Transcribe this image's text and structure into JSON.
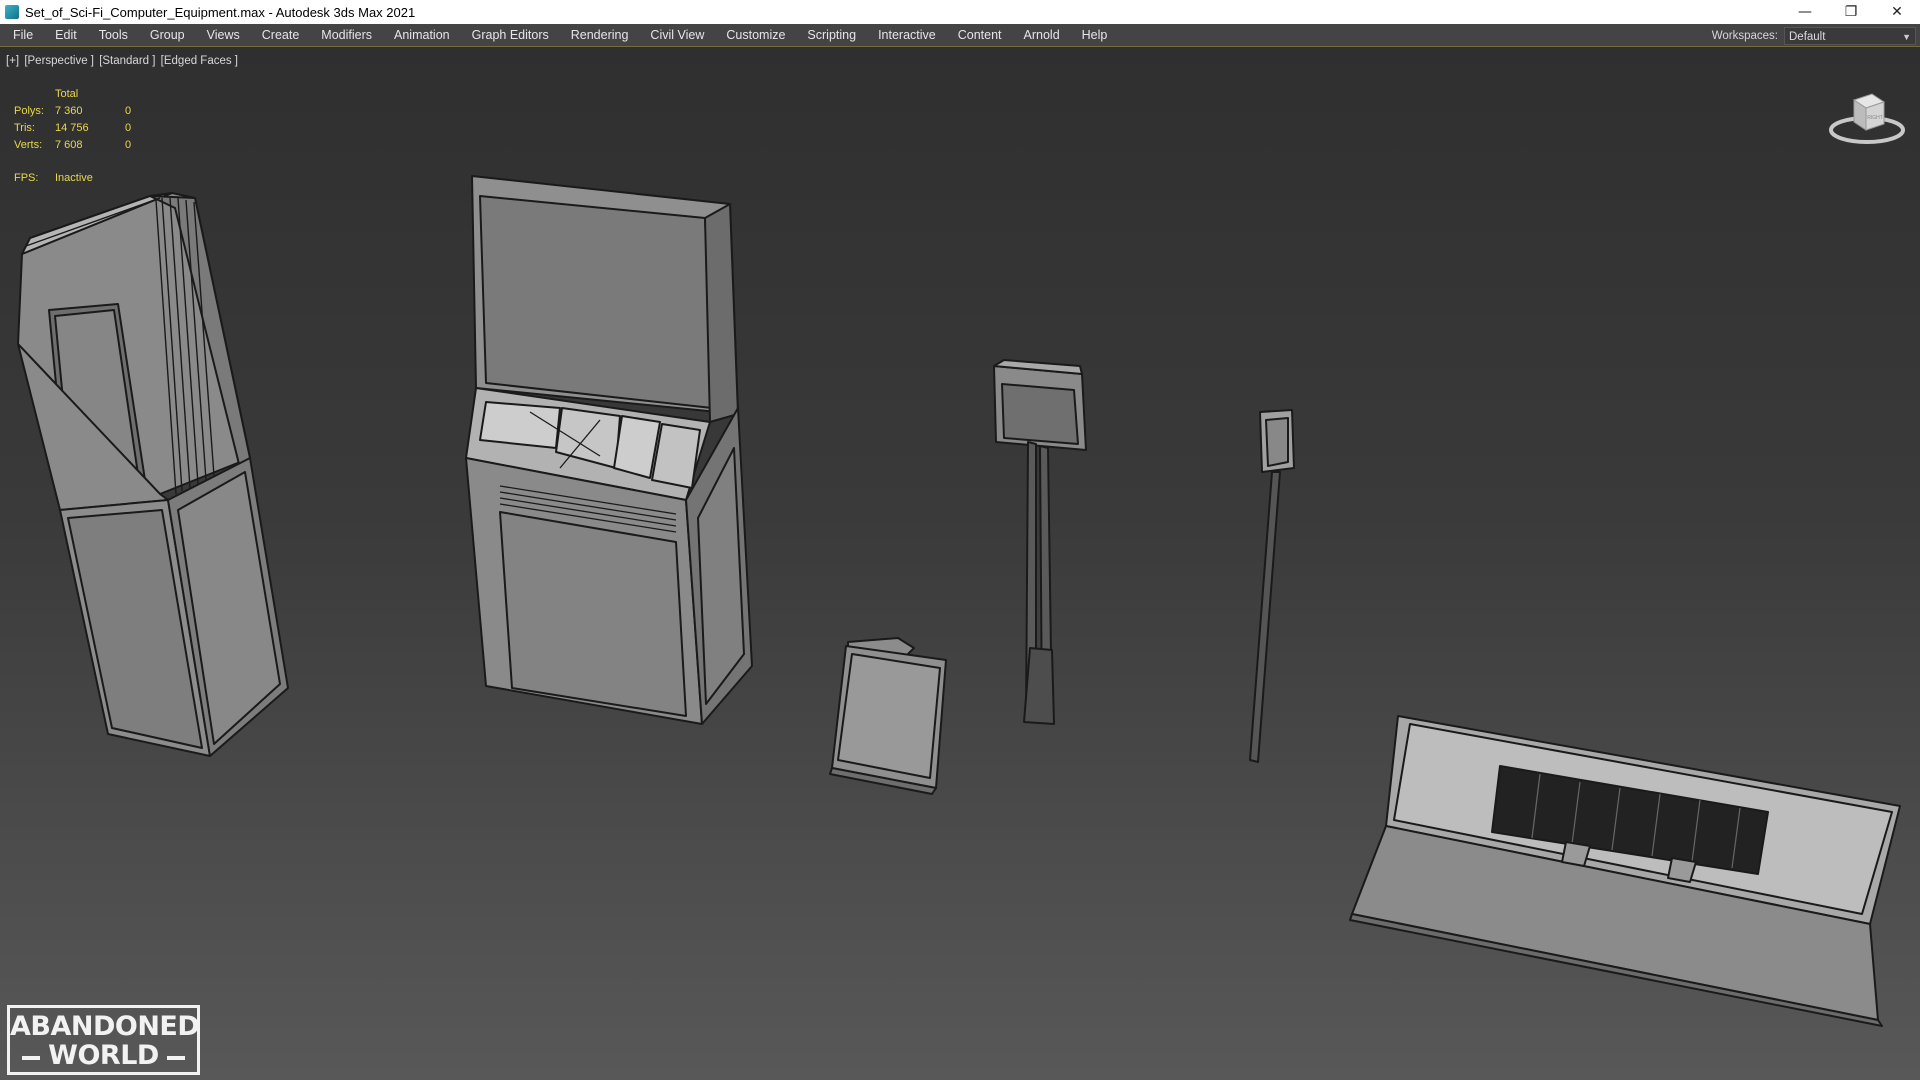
{
  "window": {
    "title": "Set_of_Sci-Fi_Computer_Equipment.max - Autodesk 3ds Max 2021",
    "minimize_glyph": "—",
    "restore_glyph": "❐",
    "close_glyph": "✕"
  },
  "menu": {
    "items": [
      "File",
      "Edit",
      "Tools",
      "Group",
      "Views",
      "Create",
      "Modifiers",
      "Animation",
      "Graph Editors",
      "Rendering",
      "Civil View",
      "Customize",
      "Scripting",
      "Interactive",
      "Content",
      "Arnold",
      "Help"
    ],
    "workspaces_label": "Workspaces:",
    "workspaces_value": "Default"
  },
  "viewport": {
    "labels": [
      "[+]",
      "[Perspective ]",
      "[Standard ]",
      "[Edged Faces ]"
    ],
    "stats": {
      "header": "Total",
      "polys_label": "Polys:",
      "polys_total": "7 360",
      "polys_sel": "0",
      "tris_label": "Tris:",
      "tris_total": "14 756",
      "tris_sel": "0",
      "verts_label": "Verts:",
      "verts_total": "7 608",
      "verts_sel": "0",
      "fps_label": "FPS:",
      "fps_value": "Inactive"
    },
    "viewcube_face": "RIGHT"
  },
  "watermark": {
    "line1": "ABANDONED",
    "line2": "WORLD"
  },
  "colors": {
    "stats_text": "#e8d848",
    "menu_bg": "#444444",
    "mesh_face": "#8e8e8e",
    "mesh_edge": "#1a1a1a"
  }
}
